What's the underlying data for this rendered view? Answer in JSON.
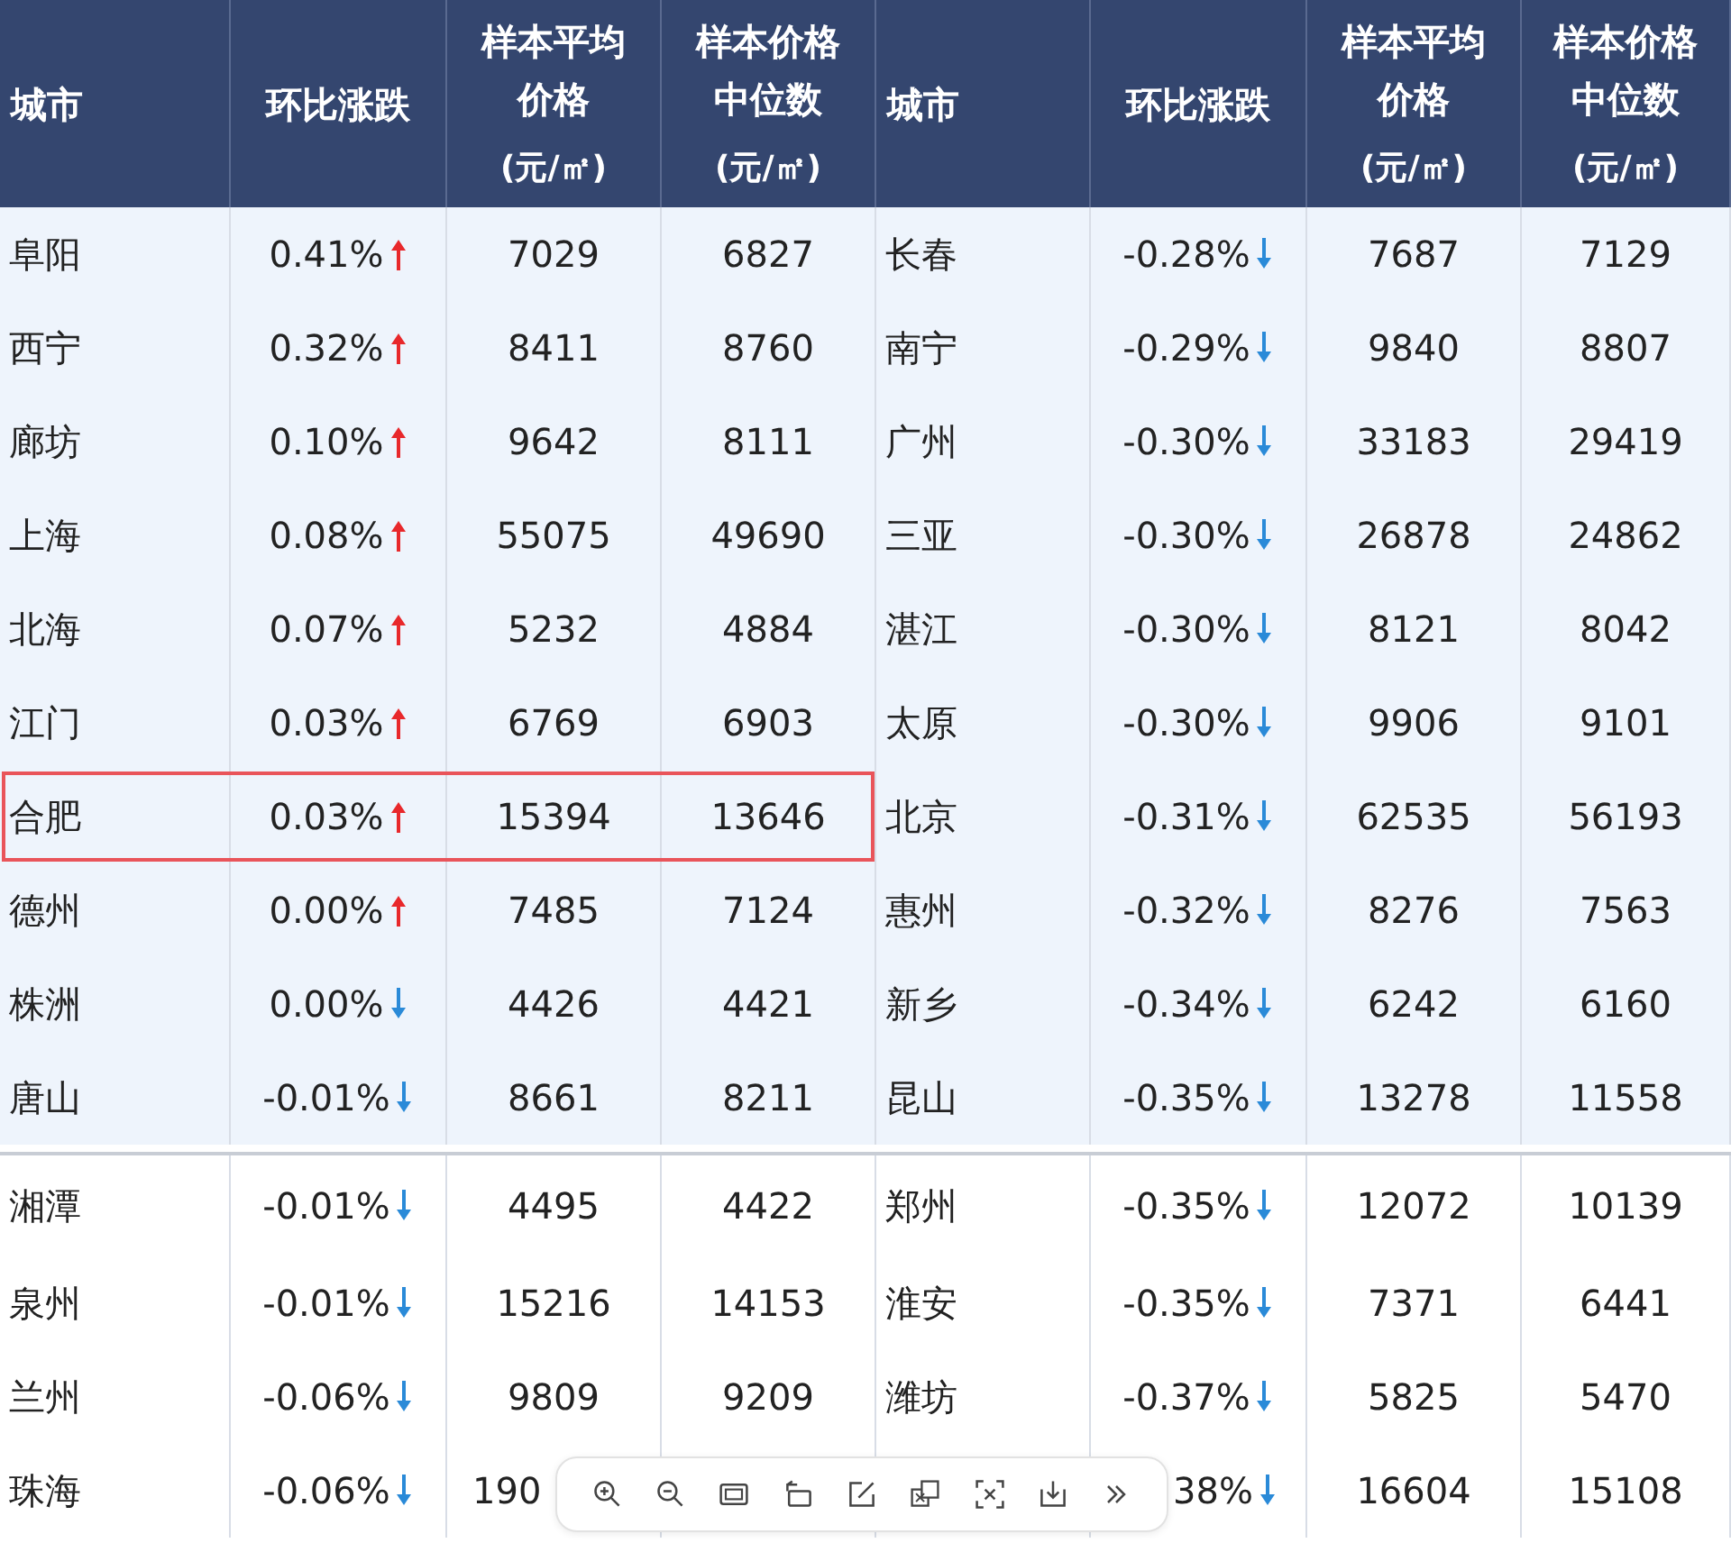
{
  "table": {
    "columns": [
      {
        "label": "城市"
      },
      {
        "label": "环比涨跌"
      },
      {
        "label": "样本平均价格",
        "unit": "(元/㎡)"
      },
      {
        "label": "样本价格中位数",
        "unit": "(元/㎡)"
      },
      {
        "label": "城市"
      },
      {
        "label": "环比涨跌"
      },
      {
        "label": "样本平均价格",
        "unit": "(元/㎡)"
      },
      {
        "label": "样本价格中位数",
        "unit": "(元/㎡)"
      }
    ],
    "rows": [
      {
        "shaded": true,
        "highlighted": false,
        "left": {
          "city": "阜阳",
          "change": "0.41%",
          "rising": true,
          "avg": "7029",
          "median": "6827"
        },
        "right": {
          "city": "长春",
          "change": "-0.28%",
          "rising": false,
          "avg": "7687",
          "median": "7129"
        }
      },
      {
        "shaded": true,
        "highlighted": false,
        "left": {
          "city": "西宁",
          "change": "0.32%",
          "rising": true,
          "avg": "8411",
          "median": "8760"
        },
        "right": {
          "city": "南宁",
          "change": "-0.29%",
          "rising": false,
          "avg": "9840",
          "median": "8807"
        }
      },
      {
        "shaded": true,
        "highlighted": false,
        "left": {
          "city": "廊坊",
          "change": "0.10%",
          "rising": true,
          "avg": "9642",
          "median": "8111"
        },
        "right": {
          "city": "广州",
          "change": "-0.30%",
          "rising": false,
          "avg": "33183",
          "median": "29419"
        }
      },
      {
        "shaded": true,
        "highlighted": false,
        "left": {
          "city": "上海",
          "change": "0.08%",
          "rising": true,
          "avg": "55075",
          "median": "49690"
        },
        "right": {
          "city": "三亚",
          "change": "-0.30%",
          "rising": false,
          "avg": "26878",
          "median": "24862"
        }
      },
      {
        "shaded": true,
        "highlighted": false,
        "left": {
          "city": "北海",
          "change": "0.07%",
          "rising": true,
          "avg": "5232",
          "median": "4884"
        },
        "right": {
          "city": "湛江",
          "change": "-0.30%",
          "rising": false,
          "avg": "8121",
          "median": "8042"
        }
      },
      {
        "shaded": true,
        "highlighted": false,
        "left": {
          "city": "江门",
          "change": "0.03%",
          "rising": true,
          "avg": "6769",
          "median": "6903"
        },
        "right": {
          "city": "太原",
          "change": "-0.30%",
          "rising": false,
          "avg": "9906",
          "median": "9101"
        }
      },
      {
        "shaded": true,
        "highlighted": true,
        "left": {
          "city": "合肥",
          "change": "0.03%",
          "rising": true,
          "avg": "15394",
          "median": "13646"
        },
        "right": {
          "city": "北京",
          "change": "-0.31%",
          "rising": false,
          "avg": "62535",
          "median": "56193"
        }
      },
      {
        "shaded": true,
        "highlighted": false,
        "left": {
          "city": "德州",
          "change": "0.00%",
          "rising": true,
          "avg": "7485",
          "median": "7124"
        },
        "right": {
          "city": "惠州",
          "change": "-0.32%",
          "rising": false,
          "avg": "8276",
          "median": "7563"
        }
      },
      {
        "shaded": true,
        "highlighted": false,
        "left": {
          "city": "株洲",
          "change": "0.00%",
          "rising": false,
          "avg": "4426",
          "median": "4421"
        },
        "right": {
          "city": "新乡",
          "change": "-0.34%",
          "rising": false,
          "avg": "6242",
          "median": "6160"
        }
      },
      {
        "shaded": true,
        "highlighted": false,
        "left": {
          "city": "唐山",
          "change": "-0.01%",
          "rising": false,
          "avg": "8661",
          "median": "8211"
        },
        "right": {
          "city": "昆山",
          "change": "-0.35%",
          "rising": false,
          "avg": "13278",
          "median": "11558"
        }
      },
      {
        "shaded": false,
        "highlighted": false,
        "left": {
          "city": "湘潭",
          "change": "-0.01%",
          "rising": false,
          "avg": "4495",
          "median": "4422"
        },
        "right": {
          "city": "郑州",
          "change": "-0.35%",
          "rising": false,
          "avg": "12072",
          "median": "10139"
        }
      },
      {
        "shaded": false,
        "highlighted": false,
        "left": {
          "city": "泉州",
          "change": "-0.01%",
          "rising": false,
          "avg": "15216",
          "median": "14153"
        },
        "right": {
          "city": "淮安",
          "change": "-0.35%",
          "rising": false,
          "avg": "7371",
          "median": "6441"
        }
      },
      {
        "shaded": false,
        "highlighted": false,
        "left": {
          "city": "兰州",
          "change": "-0.06%",
          "rising": false,
          "avg": "9809",
          "median": "9209"
        },
        "right": {
          "city": "潍坊",
          "change": "-0.37%",
          "rising": false,
          "avg": "5825",
          "median": "5470"
        }
      },
      {
        "shaded": false,
        "highlighted": false,
        "left": {
          "city": "珠海",
          "change": "-0.06%",
          "rising": false,
          "avg": "190",
          "avg_partial": true
        },
        "right": {
          "change": "38%",
          "change_partial": true,
          "rising": false,
          "avg": "16604",
          "median": "15108"
        }
      }
    ]
  }
}
